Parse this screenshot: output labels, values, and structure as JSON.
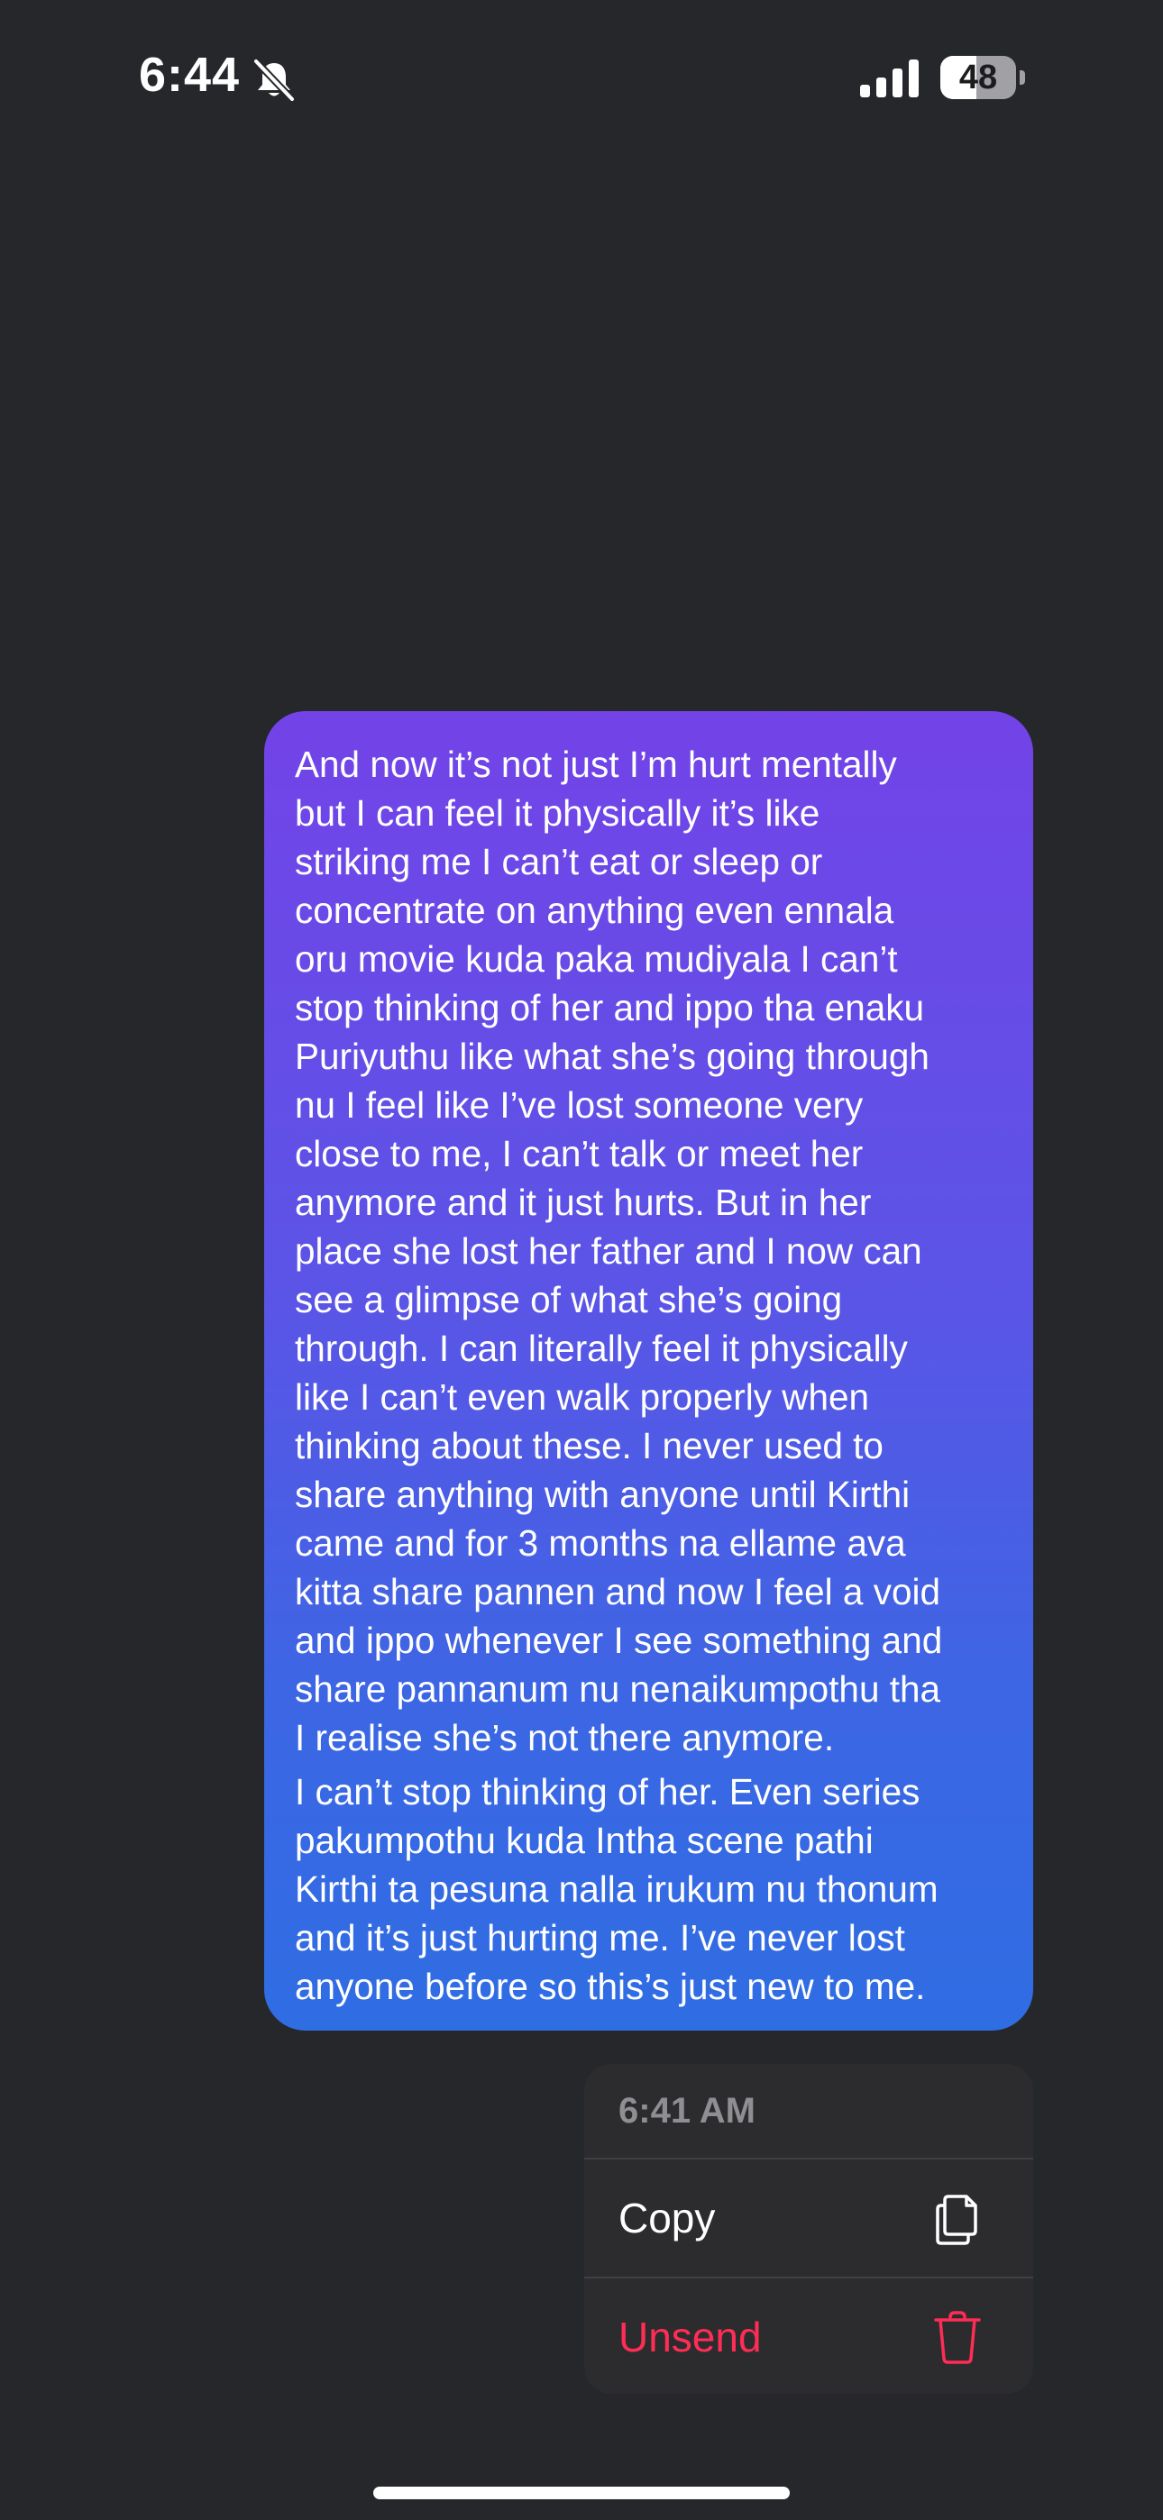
{
  "status_bar": {
    "time": "6:44",
    "silent_icon": "bell-slash-icon",
    "signal_icon": "cellular-signal-icon",
    "battery_level": 48,
    "battery_text": "48"
  },
  "message": {
    "paragraphs": [
      "And now it’s not just I’m hurt mentally\nbut I can feel it physically it’s like\nstriking me I can’t eat or sleep or\nconcentrate on anything even ennala\noru movie kuda paka mudiyala I can’t\nstop thinking of her and ippo tha enaku\nPuriyuthu like what she’s going through\nnu I feel like I’ve lost someone very\nclose to me, I can’t talk or meet her\nanymore and it just hurts. But in her\nplace she lost her father and I now can\nsee a glimpse of what she’s going\nthrough. I can literally feel it physically\nlike I can’t even walk properly when\nthinking about these. I never used to\nshare anything with anyone until Kirthi\ncame and for 3 months na ellame ava\nkitta share pannen and now I feel a void\nand ippo whenever I see something and\nshare pannanum nu nenaikumpothu tha\nI realise she’s not there anymore.",
      "I can’t stop thinking of her. Even series\npakumpothu kuda Intha scene pathi\nKirthi ta pesuna nalla irukum nu thonum\nand it’s just hurting me. I’ve never lost\nanyone before so this’s just new to me."
    ],
    "gradient_colors": [
      "#7343e8",
      "#2f6de3"
    ]
  },
  "context_menu": {
    "timestamp": "6:41 AM",
    "items": [
      {
        "label": "Copy",
        "icon": "copy-icon",
        "color": "#ffffff"
      },
      {
        "label": "Unsend",
        "icon": "trash-icon",
        "color": "#ff2d55"
      }
    ]
  }
}
